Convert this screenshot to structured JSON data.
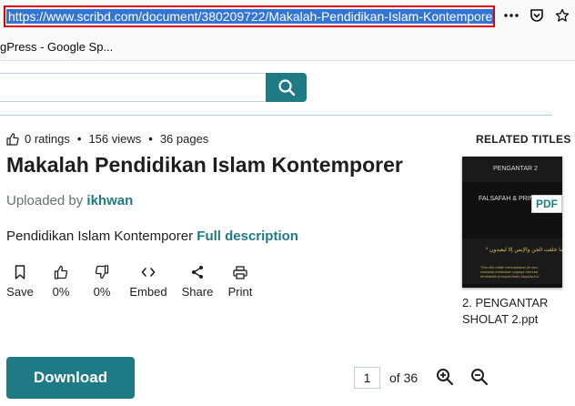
{
  "browser": {
    "url": "https://www.scribd.com/document/380209722/Makalah-Pendidikan-Islam-Kontemporer",
    "bookmark": "gPress - Google Sp..."
  },
  "search": {
    "placeholder": ""
  },
  "meta": {
    "ratings": "0 ratings",
    "views": "156 views",
    "pages": "36 pages"
  },
  "document": {
    "title": "Makalah Pendidikan Islam Kontemporer",
    "uploaded_prefix": "Uploaded by ",
    "uploader": "ikhwan",
    "description": "Pendidikan Islam Kontemporer",
    "full_description_link": "Full description"
  },
  "actions": {
    "save": "Save",
    "like_pct": "0%",
    "dislike_pct": "0%",
    "embed": "Embed",
    "share": "Share",
    "print": "Print"
  },
  "download_label": "Download",
  "pagination": {
    "current": "1",
    "of_total": "of 36"
  },
  "related": {
    "heading": "RELATED TITLES",
    "badge": "PDF",
    "thumb_line1": "PENGANTAR 2",
    "thumb_line2": "FALSAFAH & PRINSIP",
    "title": "2. PENGANTAR SHOLAT 2.ppt"
  },
  "colors": {
    "accent": "#1e7b85",
    "url_highlight": "#e00000"
  }
}
